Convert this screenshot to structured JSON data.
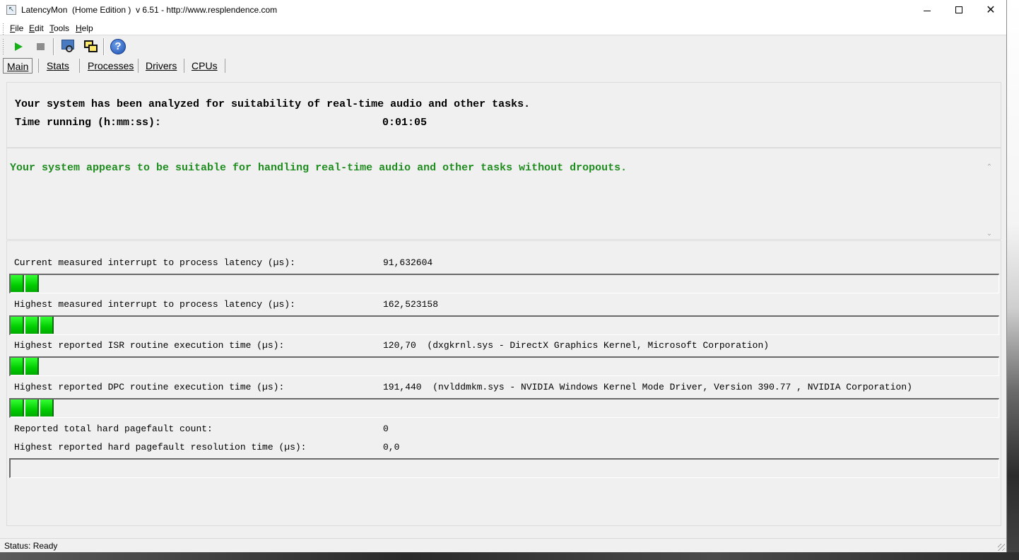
{
  "window": {
    "title": "LatencyMon  (Home Edition )  v 6.51 - http://www.resplendence.com"
  },
  "menu": {
    "items": [
      {
        "key": "F",
        "rest": "ile"
      },
      {
        "key": "E",
        "rest": "dit"
      },
      {
        "key": "T",
        "rest": "ools"
      },
      {
        "key": "H",
        "rest": "elp"
      }
    ]
  },
  "toolbar": {
    "help_glyph": "?"
  },
  "tabs": [
    {
      "key": "M",
      "rest": "ain",
      "active": true
    },
    {
      "key": "S",
      "rest": "tats",
      "active": false
    },
    {
      "key": "P",
      "rest": "rocesses",
      "active": false
    },
    {
      "key": "D",
      "rest": "rivers",
      "active": false
    },
    {
      "key": "C",
      "rest": "PUs",
      "active": false
    }
  ],
  "summary": {
    "line1": "Your system has been analyzed for suitability of real-time audio and other tasks.",
    "time_label": "Time running (h:mm:ss):",
    "time_value": "0:01:05"
  },
  "verdict": {
    "text": "Your system appears to be suitable for handling real-time audio and other tasks without dropouts.",
    "color": "#1e8c1e"
  },
  "metrics": {
    "current_latency": {
      "label": "Current measured interrupt to process latency (µs):",
      "value": "91,632604",
      "bar_segments": 2
    },
    "highest_latency": {
      "label": "Highest measured interrupt to process latency (µs):",
      "value": "162,523158",
      "bar_segments": 3
    },
    "isr": {
      "label": "Highest reported ISR routine execution time (µs):",
      "value": "120,70  (dxgkrnl.sys - DirectX Graphics Kernel, Microsoft Corporation)",
      "bar_segments": 2
    },
    "dpc": {
      "label": "Highest reported DPC routine execution time (µs):",
      "value": "191,440  (nvlddmkm.sys - NVIDIA Windows Kernel Mode Driver, Version 390.77 , NVIDIA Corporation)",
      "bar_segments": 3
    },
    "pagefault_count": {
      "label": "Reported total hard pagefault count:",
      "value": "0"
    },
    "pagefault_time": {
      "label": "Highest reported hard pagefault resolution time (µs):",
      "value": "0,0",
      "bar_segments": 0
    }
  },
  "status": {
    "text": "Status: Ready"
  },
  "colors": {
    "bar_green": "#00cc00",
    "verdict_green": "#1e8c1e"
  }
}
